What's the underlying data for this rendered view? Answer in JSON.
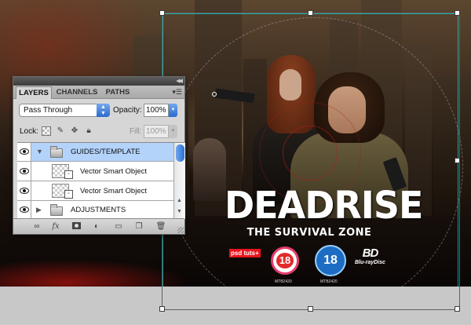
{
  "artwork": {
    "title": "DEADRISE",
    "subtitle": "THE SURVIVAL ZONE",
    "publisher_logo": "psd tuts+",
    "rating_1": "18",
    "rating_1_code": "MTB2420",
    "rating_2": "18",
    "rating_2_code": "MTB2420",
    "bluray_icon": "BD",
    "bluray_text": "Blu-rayDisc"
  },
  "layers_panel": {
    "tabs": [
      {
        "label": "LAYERS",
        "active": true
      },
      {
        "label": "CHANNELS",
        "active": false
      },
      {
        "label": "PATHS",
        "active": false
      }
    ],
    "blend_mode": "Pass Through",
    "opacity_label": "Opacity:",
    "opacity_value": "100%",
    "lock_label": "Lock:",
    "fill_label": "Fill:",
    "fill_value": "100%",
    "layers": [
      {
        "name": "GUIDES/TEMPLATE",
        "type": "group",
        "expanded": true,
        "selected": true,
        "visible": true
      },
      {
        "name": "Vector Smart Object",
        "type": "smart-object",
        "selected": false,
        "visible": true
      },
      {
        "name": "Vector Smart Object",
        "type": "smart-object",
        "selected": false,
        "visible": true
      },
      {
        "name": "ADJUSTMENTS",
        "type": "group",
        "expanded": false,
        "selected": false,
        "visible": true
      }
    ],
    "footer_icons": [
      "link-icon",
      "fx-icon",
      "mask-icon",
      "adjustment-icon",
      "new-group-icon",
      "new-layer-icon",
      "trash-icon"
    ]
  },
  "colors": {
    "selection_blue": "#b3d3fb",
    "accent_blue": "#2a69cf",
    "title_white": "#ffffff",
    "rating_red": "#e32929",
    "rating_blue": "#1d6cc4"
  }
}
